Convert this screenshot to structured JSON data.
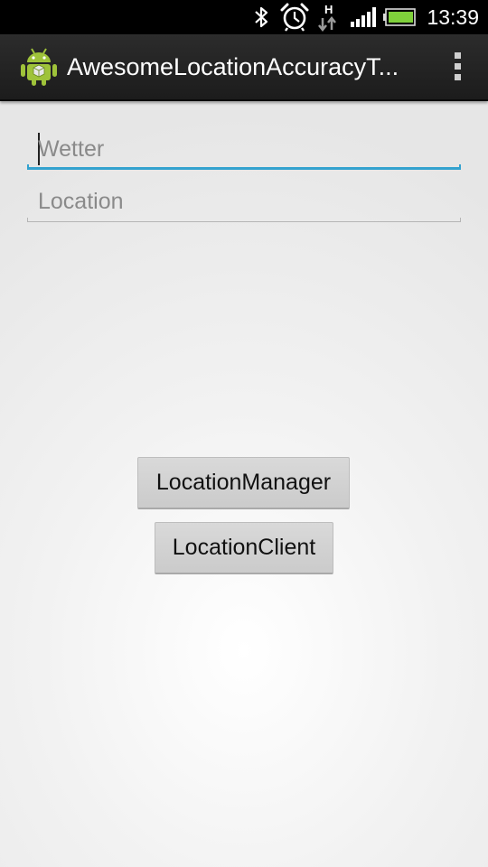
{
  "status_bar": {
    "time": "13:39",
    "icons": [
      "bluetooth-icon",
      "alarm-icon",
      "hspa-data-icon",
      "signal-icon",
      "battery-icon"
    ],
    "hspa_label": "H"
  },
  "action_bar": {
    "title": "AwesomeLocationAccuracyT...",
    "icon": "android-app-icon",
    "menu_icon": "overflow-menu-icon"
  },
  "form": {
    "fields": [
      {
        "placeholder": "Wetter",
        "value": "",
        "focused": true
      },
      {
        "placeholder": "Location",
        "value": "",
        "focused": false
      }
    ],
    "buttons": [
      {
        "label": "LocationManager"
      },
      {
        "label": "LocationClient"
      }
    ]
  },
  "colors": {
    "accent": "#33a2cf",
    "action_bar": "#222222",
    "status_bar": "#000000",
    "battery": "#7fd13b",
    "android_green": "#9fc33a"
  }
}
